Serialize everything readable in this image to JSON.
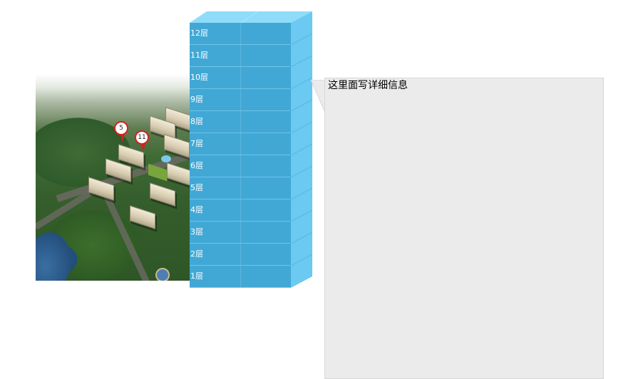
{
  "map": {
    "pins": [
      {
        "label": "5"
      },
      {
        "label": "11"
      }
    ]
  },
  "building": {
    "floors": [
      "12层",
      "11层",
      "10层",
      "9层",
      "8层",
      "7层",
      "6层",
      "5层",
      "4层",
      "3层",
      "2层",
      "1层"
    ],
    "colors": {
      "face": "#41a8d6",
      "side": "#6bc9f2",
      "top": "#8fdcfa"
    }
  },
  "detail": {
    "text": "这里面写详细信息"
  }
}
